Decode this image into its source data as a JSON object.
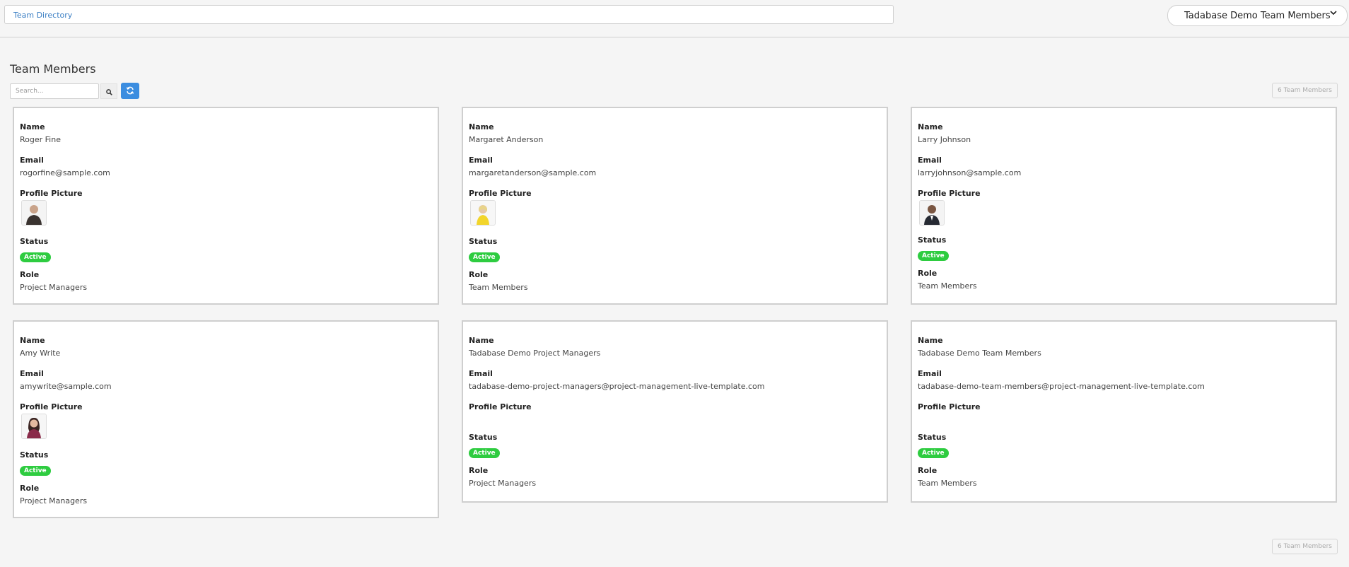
{
  "header": {
    "breadcrumb": "Team Directory",
    "user_menu": "Tadabase Demo Team Members"
  },
  "page": {
    "title": "Team Members",
    "search_placeholder": "Search...",
    "count_label": "6 Team Members"
  },
  "field_labels": {
    "name": "Name",
    "email": "Email",
    "picture": "Profile Picture",
    "status": "Status",
    "role": "Role"
  },
  "members": [
    {
      "name": "Roger Fine",
      "email": "rogorfine@sample.com",
      "picture": "man-dark-shirt",
      "status": "Active",
      "role": "Project Managers"
    },
    {
      "name": "Margaret Anderson",
      "email": "margaretanderson@sample.com",
      "picture": "woman-yellow",
      "status": "Active",
      "role": "Team Members"
    },
    {
      "name": "Larry Johnson",
      "email": "larryjohnson@sample.com",
      "picture": "man-suit",
      "status": "Active",
      "role": "Team Members"
    },
    {
      "name": "Amy Write",
      "email": "amywrite@sample.com",
      "picture": "woman-dark-hair",
      "status": "Active",
      "role": "Project Managers"
    },
    {
      "name": "Tadabase Demo Project Managers",
      "email": "tadabase-demo-project-managers@project-management-live-template.com",
      "picture": "",
      "status": "Active",
      "role": "Project Managers"
    },
    {
      "name": "Tadabase Demo Team Members",
      "email": "tadabase-demo-team-members@project-management-live-template.com",
      "picture": "",
      "status": "Active",
      "role": "Team Members"
    }
  ],
  "colors": {
    "accent": "#3b8de0",
    "link": "#3b7fc4",
    "status_active": "#2ecc40"
  }
}
